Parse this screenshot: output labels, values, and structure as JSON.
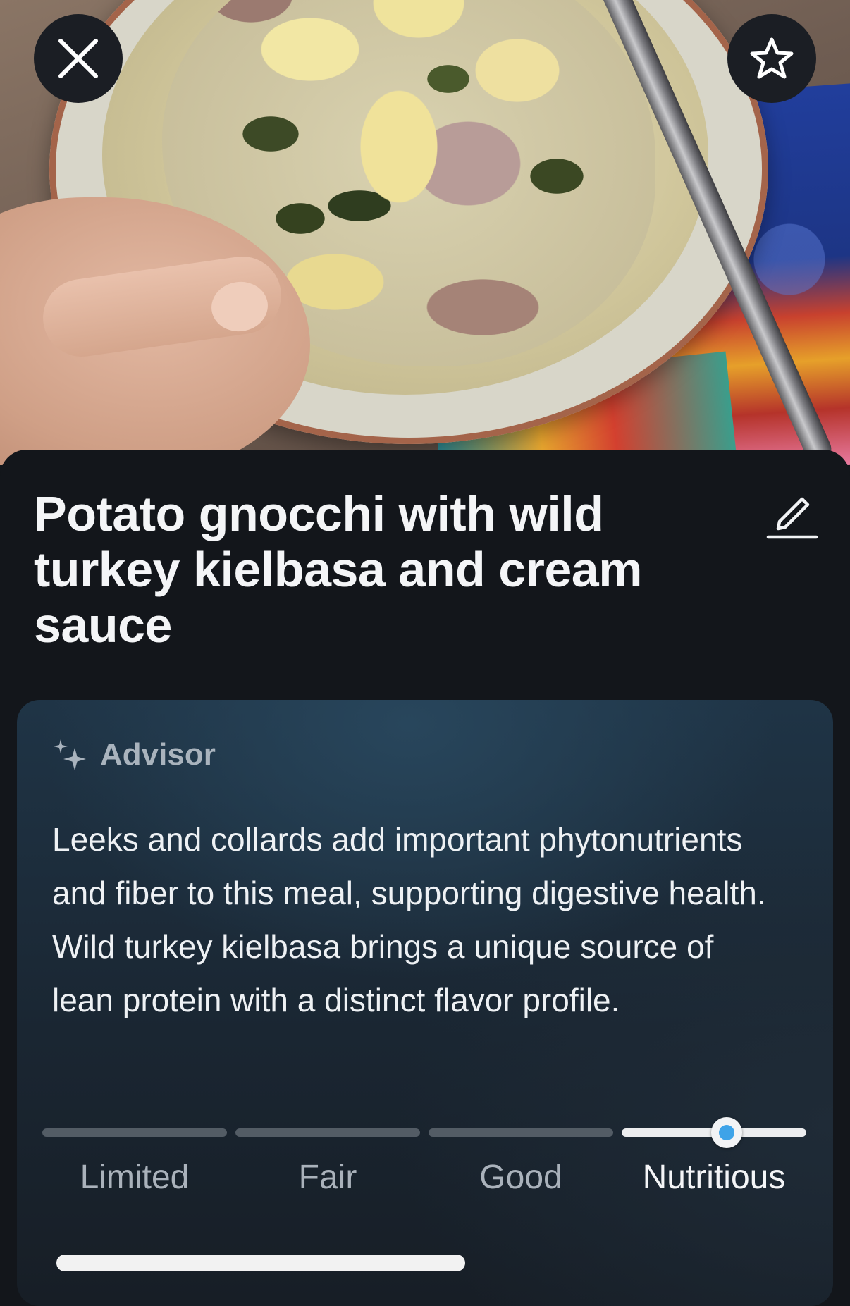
{
  "header": {
    "close_icon": "close-icon",
    "favorite_icon": "star-icon"
  },
  "meal": {
    "title": "Potato gnocchi with wild turkey kielbasa and cream sauce",
    "edit_icon": "pencil-icon"
  },
  "advisor": {
    "icon": "sparkles-icon",
    "label": "Advisor",
    "text": "Leeks and collards add important phytonutrients and fiber to this meal, supporting digestive health. Wild turkey kielbasa brings a unique source of lean protein with a distinct flavor profile."
  },
  "rating": {
    "levels": [
      "Limited",
      "Fair",
      "Good",
      "Nutritious"
    ],
    "selected": "Nutritious",
    "position_within_selected": 0.57,
    "accent_color": "#3ea3e8"
  }
}
